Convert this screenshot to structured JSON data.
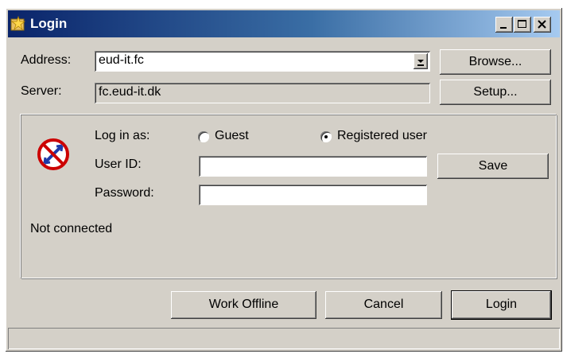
{
  "window": {
    "title": "Login",
    "icon": "login-star-icon",
    "controls": {
      "minimize": "minimize-icon",
      "maximize": "maximize-icon",
      "close": "close-icon"
    }
  },
  "connection": {
    "address_label": "Address:",
    "address_value": "eud-it.fc",
    "browse_label": "Browse...",
    "server_label": "Server:",
    "server_value": "fc.eud-it.dk",
    "setup_label": "Setup..."
  },
  "login": {
    "status_icon": "disconnected-icon",
    "log_in_as_label": "Log in as:",
    "options": [
      {
        "label": "Guest",
        "selected": false
      },
      {
        "label": "Registered user",
        "selected": true
      }
    ],
    "user_id_label": "User ID:",
    "user_id_value": "",
    "save_label": "Save",
    "password_label": "Password:",
    "password_value": "",
    "status_text": "Not connected"
  },
  "actions": {
    "work_offline_label": "Work Offline",
    "cancel_label": "Cancel",
    "login_label": "Login"
  },
  "colors": {
    "title_gradient_start": "#0a246a",
    "title_gradient_end": "#a6caf0",
    "window_face": "#d4d0c8",
    "status_icon_red": "#cc0000",
    "status_icon_blue": "#1f3aa8"
  }
}
